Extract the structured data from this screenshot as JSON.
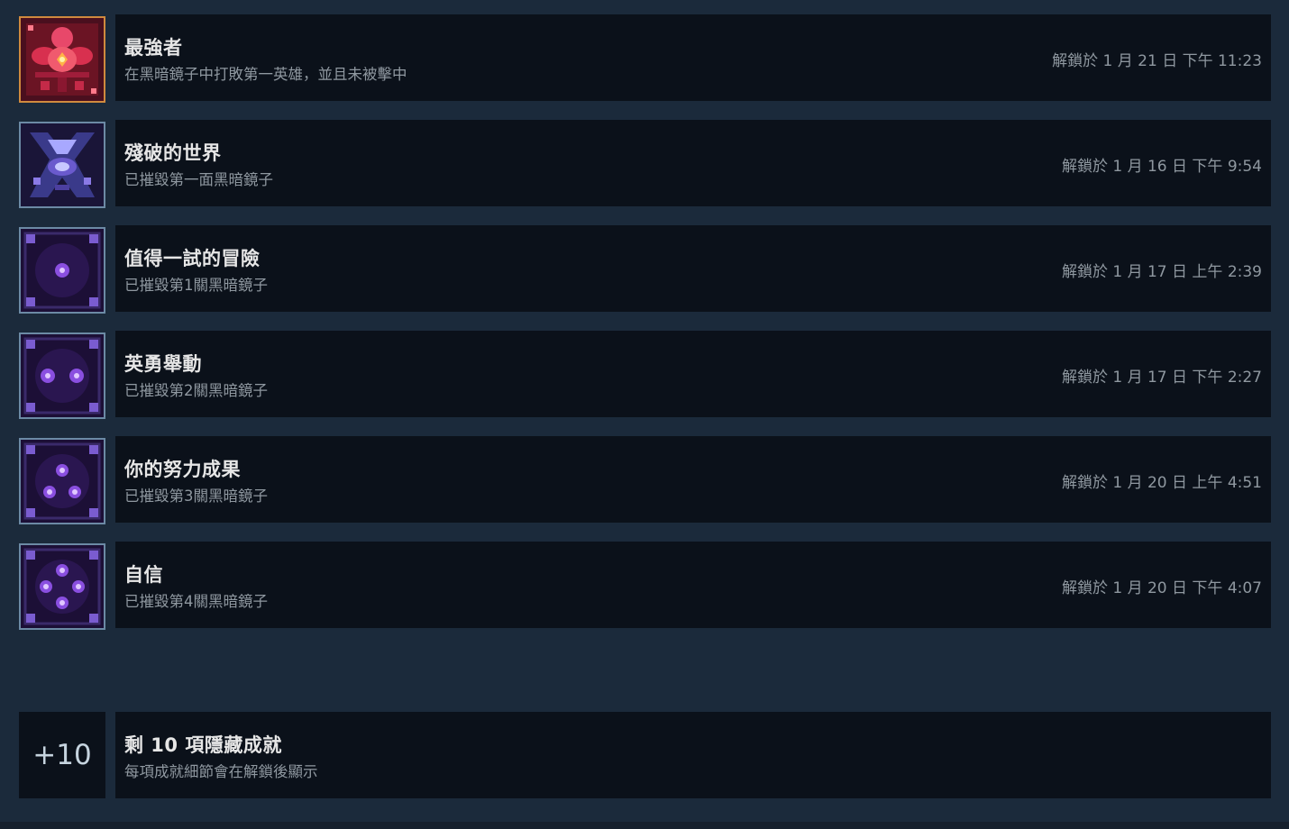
{
  "achievements": [
    {
      "title": "最強者",
      "description": "在黑暗鏡子中打敗第一英雄，並且未被擊中",
      "unlocked": "解鎖於 1 月 21 日 下午 11:23",
      "icon": "red-demon-flower-icon"
    },
    {
      "title": "殘破的世界",
      "description": "已摧毀第一面黑暗鏡子",
      "unlocked": "解鎖於 1 月 16 日 下午 9:54",
      "icon": "shattered-crystal-icon"
    },
    {
      "title": "值得一試的冒險",
      "description": "已摧毀第1關黑暗鏡子",
      "unlocked": "解鎖於 1 月 17 日 上午 2:39",
      "icon": "purple-one-orb-icon"
    },
    {
      "title": "英勇舉動",
      "description": "已摧毀第2關黑暗鏡子",
      "unlocked": "解鎖於 1 月 17 日 下午 2:27",
      "icon": "purple-two-orbs-icon"
    },
    {
      "title": "你的努力成果",
      "description": "已摧毀第3關黑暗鏡子",
      "unlocked": "解鎖於 1 月 20 日 上午 4:51",
      "icon": "purple-three-orbs-icon"
    },
    {
      "title": "自信",
      "description": "已摧毀第4關黑暗鏡子",
      "unlocked": "解鎖於 1 月 20 日 下午 4:07",
      "icon": "purple-four-orbs-icon"
    }
  ],
  "hidden": {
    "count_label": "+10",
    "title": "剩 10 項隱藏成就",
    "description": "每項成就細節會在解鎖後顯示"
  },
  "colors": {
    "background": "#1b2838",
    "row": "#0b111a",
    "title": "#e6e6e6",
    "muted": "#8f98a0",
    "icon_border": "#6c8aa5",
    "gold_border": "#d08a3e"
  }
}
